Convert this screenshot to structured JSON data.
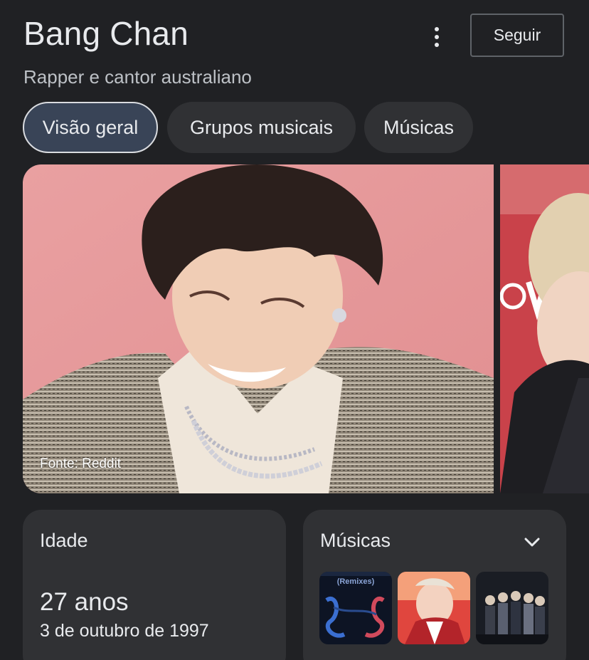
{
  "header": {
    "title": "Bang Chan",
    "subtitle": "Rapper e cantor australiano",
    "follow_label": "Seguir",
    "more_icon": "more-vert-icon"
  },
  "tabs": [
    {
      "label": "Visão geral",
      "active": true
    },
    {
      "label": "Grupos musicais",
      "active": false
    },
    {
      "label": "Músicas",
      "active": false
    }
  ],
  "gallery": {
    "main_caption": "Fonte: Reddit"
  },
  "age_card": {
    "title": "Idade",
    "value": "27 anos",
    "birthdate": "3 de outubro de 1997"
  },
  "songs_card": {
    "title": "Músicas",
    "expand_icon": "chevron-down-icon",
    "thumbnails": [
      {
        "label": "(Remixes)"
      },
      {
        "label": ""
      },
      {
        "label": ""
      }
    ]
  },
  "colors": {
    "background": "#202124",
    "surface": "#303134",
    "active_tab": "#394457",
    "text": "#e8eaed"
  }
}
